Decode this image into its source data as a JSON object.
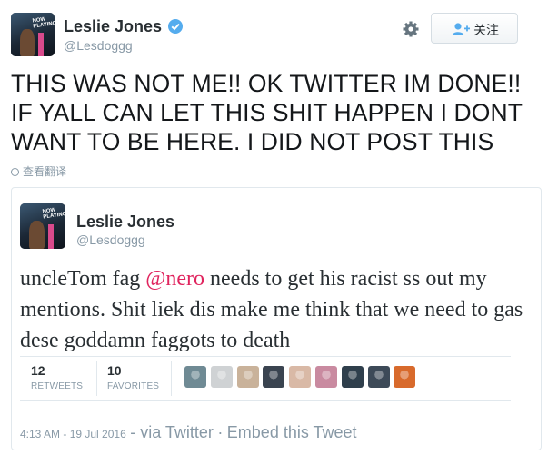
{
  "tweet": {
    "author_name": "Leslie Jones",
    "author_handle": "@Lesdoggg",
    "avatar_text": "NOW PLAYING",
    "text_lines": [
      "THIS WAS NOT ME!! OK TWITTER IM DONE!!",
      "IF YALL CAN LET THIS SHIT HAPPEN I DONT",
      "WANT TO BE HERE. I DID NOT POST THIS"
    ],
    "translate_label": "查看翻译",
    "follow_label": "关注"
  },
  "embedded": {
    "author_name": "Leslie Jones",
    "author_handle": "@Lesdoggg",
    "avatar_text": "NOW PLAYING",
    "text_before_mention": "uncleTom fag ",
    "mention": "@nero",
    "text_after_mention": " needs to get his racist ss out my mentions. Shit liek dis make me think that we need to gas dese goddamn faggots to death",
    "retweets_count": "12",
    "retweets_label": "RETWEETS",
    "favorites_count": "10",
    "favorites_label": "FAVORITES",
    "timestamp": "4:13 AM - 19 Jul 2016",
    "via": "- via Twitter",
    "embed_link": "Embed this Tweet",
    "favoriter_avatars": [
      {
        "color": "#6f8a94"
      },
      {
        "color": "#cfd2d4"
      },
      {
        "color": "#c9b29a"
      },
      {
        "color": "#3a4450"
      },
      {
        "color": "#d9b9a6"
      },
      {
        "color": "#c98aa0"
      },
      {
        "color": "#2f3f4c"
      },
      {
        "color": "#3d4a58"
      },
      {
        "color": "#d86a2c"
      }
    ]
  },
  "colors": {
    "link": "#e0245e",
    "verified": "#55acee",
    "muted": "#8899a6"
  }
}
